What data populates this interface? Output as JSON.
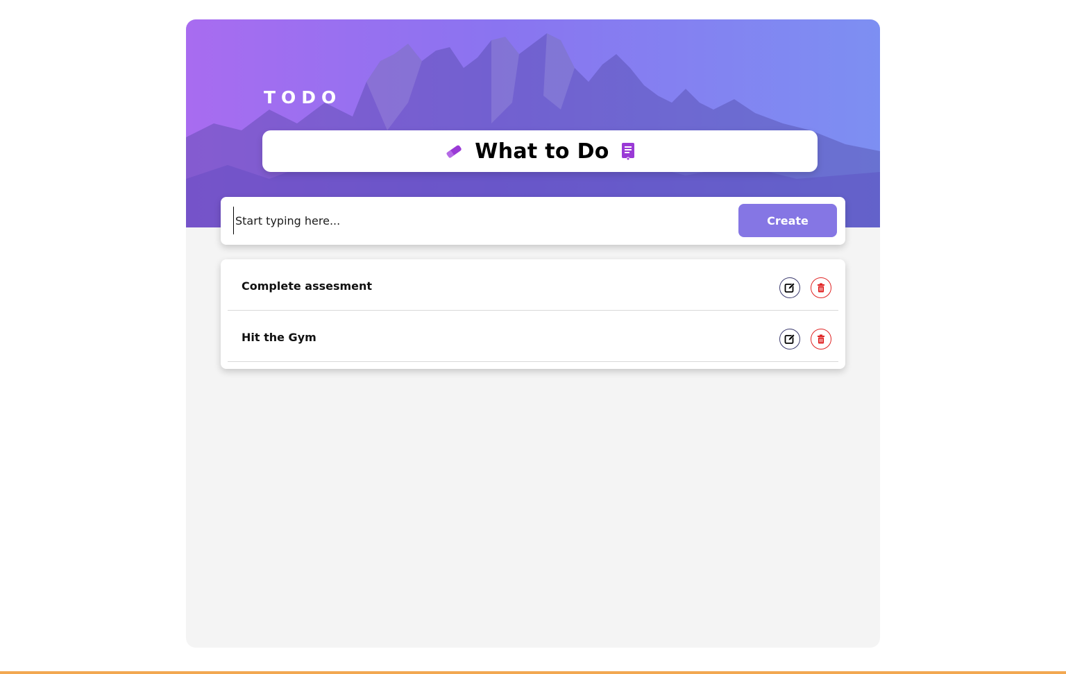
{
  "brand": "TODO",
  "header": {
    "title": "What to Do",
    "left_icon": "eraser-icon",
    "right_icon": "notepad-icon",
    "icon_color": "#9a3ad6"
  },
  "composer": {
    "placeholder": "Start typing here...",
    "value": "",
    "create_label": "Create",
    "create_color": "#8576e4"
  },
  "todos": [
    {
      "text": "Complete assesment",
      "edit_icon": "edit-icon",
      "delete_icon": "trash-icon"
    },
    {
      "text": "Hit the Gym",
      "edit_icon": "edit-icon",
      "delete_icon": "trash-icon"
    }
  ],
  "colors": {
    "hero_gradient_start": "#a86cf0",
    "hero_gradient_end": "#7d8ff2",
    "delete_accent": "#e02424",
    "edit_accent": "#3b3a6e",
    "bottom_bar": "#f2a851"
  }
}
